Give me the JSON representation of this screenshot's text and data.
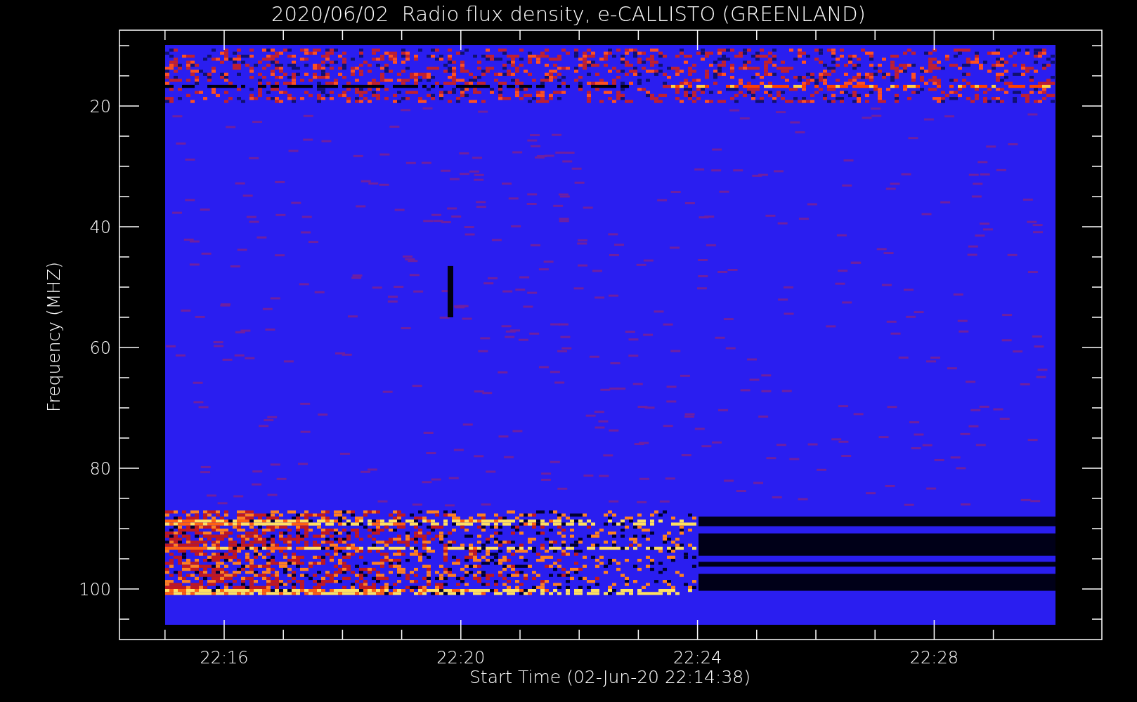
{
  "title": "2020/06/02  Radio flux density, e-CALLISTO (GREENLAND)",
  "y_axis": {
    "label": "Frequency (MHZ)",
    "ticks": [
      "20",
      "40",
      "60",
      "80",
      "100"
    ]
  },
  "x_axis": {
    "label": "Start Time (02-Jun-20 22:14:38)",
    "ticks": [
      "22:16",
      "22:20",
      "22:24",
      "22:28"
    ]
  }
}
